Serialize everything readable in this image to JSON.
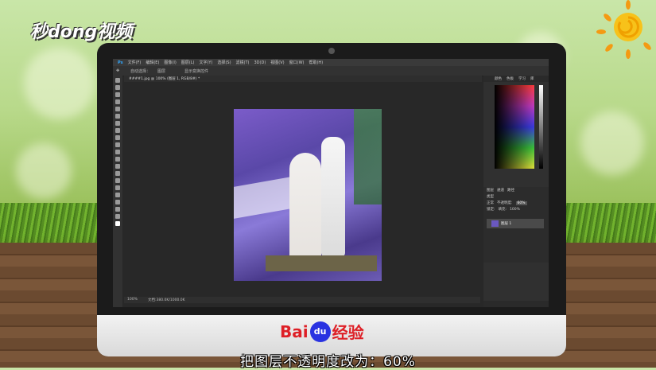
{
  "brand": {
    "top_left_logo": "秒dong视频",
    "baidu_bai": "Bai",
    "baidu_du": "du",
    "baidu_jy": "经验"
  },
  "caption": "把图层不透明度改为：60%",
  "photoshop": {
    "menu": [
      "文件(F)",
      "编辑(E)",
      "图像(I)",
      "图层(L)",
      "文字(Y)",
      "选择(S)",
      "滤镜(T)",
      "3D(D)",
      "视图(V)",
      "窗口(W)",
      "帮助(H)"
    ],
    "options": {
      "auto_select": "自动选择：",
      "group": "图层",
      "transform": "显示变换控件"
    },
    "doc_tab": "####1.jpg @ 100% (图层 1, RGB/8#) *",
    "status": {
      "zoom": "100%",
      "doc_size": "文档:380.0K/1000.0K"
    },
    "color_tabs": [
      "颜色",
      "色板",
      "学习",
      "库"
    ],
    "layers_tabs": [
      "图层",
      "通道",
      "路径"
    ],
    "layers": {
      "kind_label": "类型",
      "blend_mode": "正常",
      "opacity_label": "不透明度:",
      "opacity_value": "60%",
      "lock_label": "锁定:",
      "fill_label": "填充:",
      "fill_value": "100%",
      "layer_name": "图层 1"
    }
  },
  "colors": {
    "baidu_red": "#de1f26",
    "baidu_blue": "#2932e1",
    "ps_dark": "#282828"
  }
}
